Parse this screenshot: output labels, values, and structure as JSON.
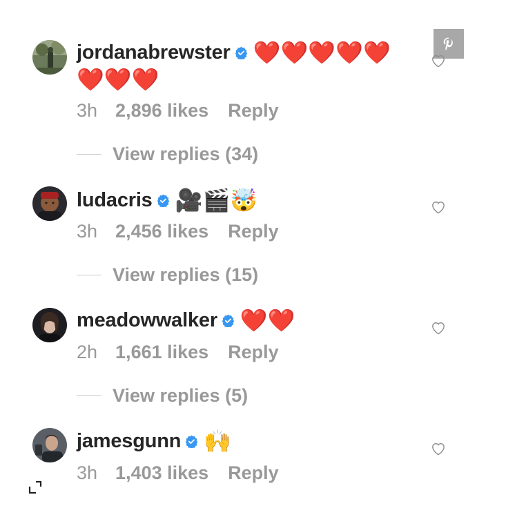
{
  "comments": [
    {
      "username": "jordanabrewster",
      "verified": true,
      "text_line1": "❤️❤️❤️❤️❤️",
      "text_line2": "❤️❤️❤️",
      "time": "3h",
      "likes": "2,896 likes",
      "reply": "Reply",
      "view_replies": "View replies (34)",
      "avatar_icon": "avatar-photo"
    },
    {
      "username": "ludacris",
      "verified": true,
      "text_line1": "🎥🎬🤯",
      "time": "3h",
      "likes": "2,456 likes",
      "reply": "Reply",
      "view_replies": "View replies (15)",
      "avatar_icon": "avatar-photo"
    },
    {
      "username": "meadowwalker",
      "verified": true,
      "text_line1": "❤️❤️",
      "time": "2h",
      "likes": "1,661 likes",
      "reply": "Reply",
      "view_replies": "View replies (5)",
      "avatar_icon": "avatar-photo"
    },
    {
      "username": "jamesgunn",
      "verified": true,
      "text_line1": "🙌",
      "time": "3h",
      "likes": "1,403 likes",
      "reply": "Reply",
      "avatar_icon": "avatar-photo"
    }
  ],
  "icons": {
    "verified": "verified-badge-icon",
    "like": "heart-outline-icon",
    "pin": "pinterest-icon",
    "expand": "expand-corner-icon"
  },
  "colors": {
    "username": "#262626",
    "meta": "#999999",
    "verified": "#3897f0",
    "heart": "#e0152a",
    "pin_bg": "#a8a8a8"
  }
}
